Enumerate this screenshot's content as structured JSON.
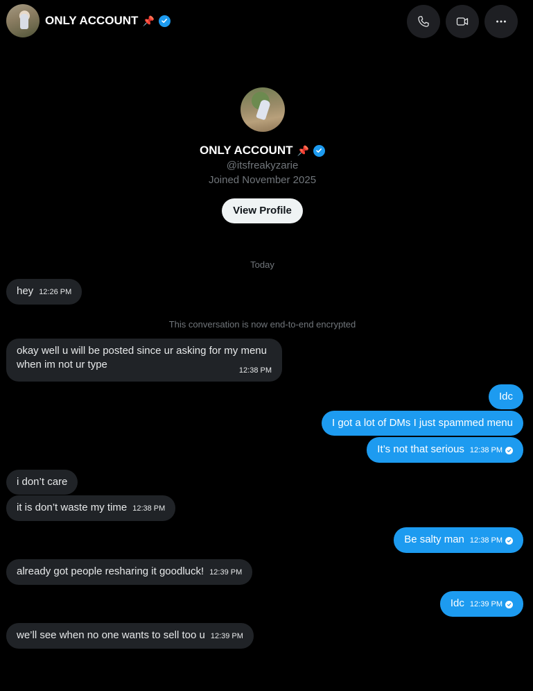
{
  "header": {
    "name": "ONLY ACCOUNT",
    "pin": "📌",
    "icons": [
      "phone-icon",
      "video-icon",
      "more-icon"
    ]
  },
  "profile": {
    "name": "ONLY ACCOUNT",
    "pin": "📌",
    "handle": "@itsfreakyzarie",
    "joined": "Joined November 2025",
    "view_button": "View Profile"
  },
  "meta": {
    "today": "Today",
    "encrypted": "This conversation is now end-to-end encrypted"
  },
  "messages": [
    {
      "side": "received",
      "text": "hey",
      "time": "12:26 PM"
    },
    {
      "side": "received",
      "text": "okay well u will be posted since ur asking for my menu when im not ur type",
      "time": "12:38 PM"
    },
    {
      "side": "sent",
      "text": "Idc",
      "time": ""
    },
    {
      "side": "sent",
      "text": "I got a lot of DMs I just spammed menu",
      "time": ""
    },
    {
      "side": "sent",
      "text": "It’s not that serious",
      "time": "12:38 PM"
    },
    {
      "side": "received",
      "text": "i don’t care",
      "time": ""
    },
    {
      "side": "received",
      "text": "it is don’t waste my time",
      "time": "12:38 PM"
    },
    {
      "side": "sent",
      "text": "Be salty man",
      "time": "12:38 PM"
    },
    {
      "side": "received",
      "text": "already got people resharing it goodluck!",
      "time": "12:39 PM"
    },
    {
      "side": "sent",
      "text": "Idc",
      "time": "12:39 PM"
    },
    {
      "side": "received",
      "text": "we’ll see when no one wants to sell too u",
      "time": "12:39 PM"
    }
  ],
  "colors": {
    "background": "#000000",
    "received_bubble": "#202327",
    "sent_bubble": "#1d9bf0",
    "verified": "#1d9bf0",
    "muted_text": "#71767b"
  }
}
